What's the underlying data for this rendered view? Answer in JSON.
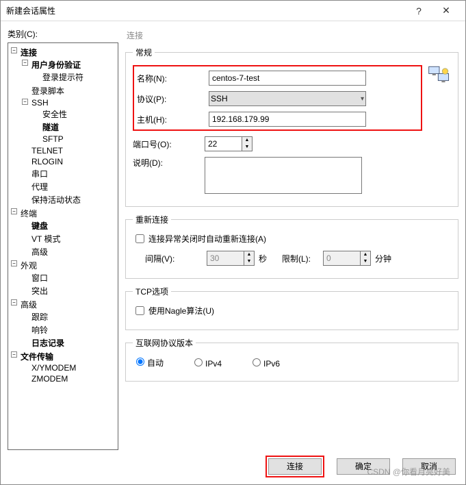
{
  "title": "新建会话属性",
  "category_label": "类别(C):",
  "tree": {
    "connection": "连接",
    "auth": "用户身份验证",
    "login_prompt": "登录提示符",
    "login_script": "登录脚本",
    "ssh": "SSH",
    "security": "安全性",
    "tunnel": "隧道",
    "sftp": "SFTP",
    "telnet": "TELNET",
    "rlogin": "RLOGIN",
    "serial": "串口",
    "proxy": "代理",
    "keepalive": "保持活动状态",
    "terminal": "终端",
    "keyboard": "键盘",
    "vtmode": "VT 模式",
    "advanced1": "高级",
    "appearance": "外观",
    "window": "窗口",
    "highlight": "突出",
    "advanced2": "高级",
    "trace": "跟踪",
    "bell": "响铃",
    "logging": "日志记录",
    "filetrans": "文件传输",
    "xymodem": "X/YMODEM",
    "zmodem": "ZMODEM"
  },
  "panel_title": "连接",
  "general": {
    "legend": "常规",
    "name_lbl": "名称(N):",
    "name_val": "centos-7-test",
    "proto_lbl": "协议(P):",
    "proto_val": "SSH",
    "host_lbl": "主机(H):",
    "host_val": "192.168.179.99",
    "port_lbl": "端口号(O):",
    "port_val": "22",
    "desc_lbl": "说明(D):",
    "desc_val": ""
  },
  "reconnect": {
    "legend": "重新连接",
    "auto_lbl": "连接异常关闭时自动重新连接(A)",
    "interval_lbl": "间隔(V):",
    "interval_val": "30",
    "sec": "秒",
    "limit_lbl": "限制(L):",
    "limit_val": "0",
    "min": "分钟"
  },
  "tcp": {
    "legend": "TCP选项",
    "nagle_lbl": "使用Nagle算法(U)"
  },
  "ipver": {
    "legend": "互联网协议版本",
    "auto": "自动",
    "ipv4": "IPv4",
    "ipv6": "IPv6"
  },
  "buttons": {
    "connect": "连接",
    "ok": "确定",
    "cancel": "取消"
  },
  "watermark": "CSDN @你看月亮好美"
}
